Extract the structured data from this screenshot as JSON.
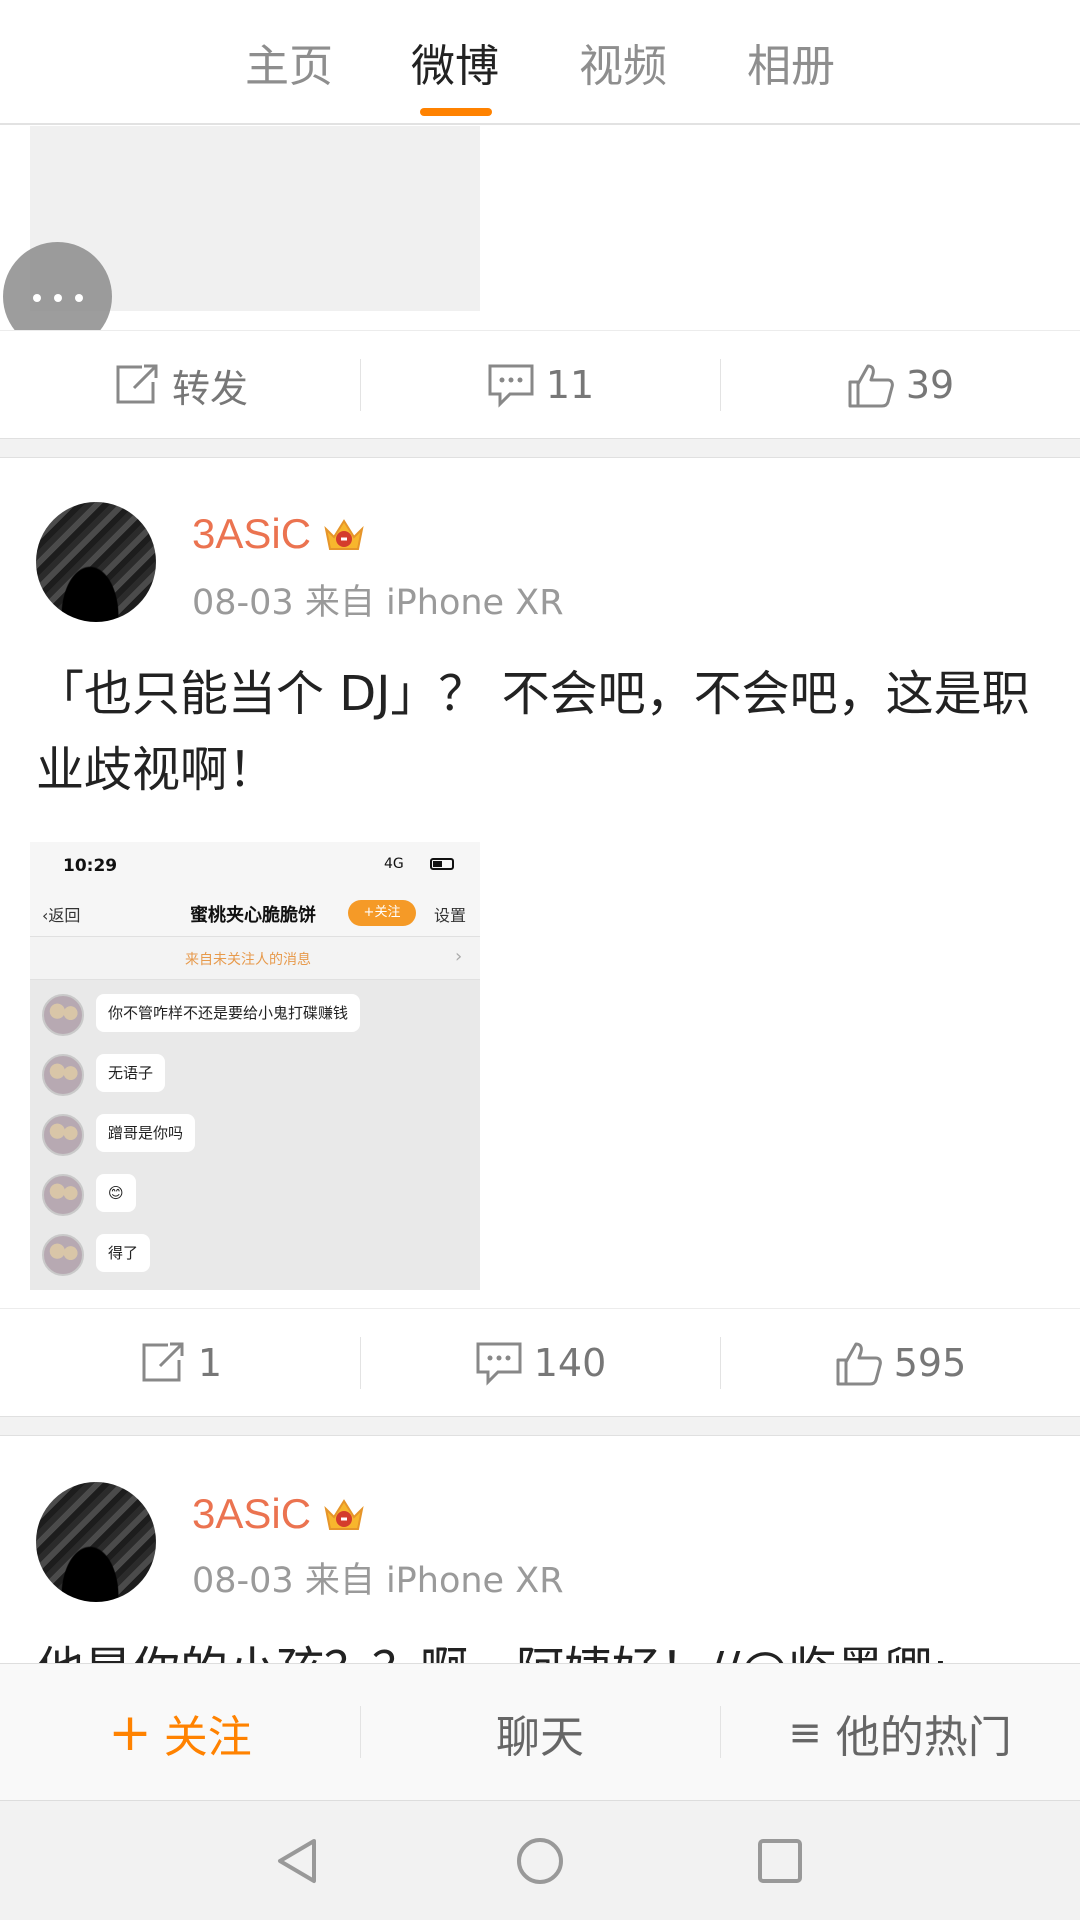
{
  "tabs": [
    {
      "label": "主页",
      "active": false
    },
    {
      "label": "微博",
      "active": true
    },
    {
      "label": "视频",
      "active": false
    },
    {
      "label": "相册",
      "active": false
    }
  ],
  "accent_color": "#ff8200",
  "username_color": "#eb7350",
  "post0": {
    "more_icon": "more-dots-icon",
    "actions": {
      "repost": "转发",
      "comments": "11",
      "likes": "39"
    }
  },
  "posts": [
    {
      "username": "3ASiC",
      "badge_icon": "crown-vip-icon",
      "meta": "08-03 来自 iPhone XR",
      "text": "「也只能当个 DJ」？ 不会吧，不会吧，这是职业歧视啊！",
      "image": {
        "time": "10:29",
        "signal": "4G",
        "back": "返回",
        "title": "蜜桃夹心脆脆饼",
        "follow": "+关注",
        "settings": "设置",
        "notice": "来自未关注人的消息",
        "messages": [
          "你不管咋样不还是要给小鬼打碟赚钱",
          "无语子",
          "蹭哥是你吗",
          "😊",
          "得了"
        ]
      },
      "actions": {
        "repost": "1",
        "comments": "140",
        "likes": "595"
      }
    },
    {
      "username": "3ASiC",
      "badge_icon": "crown-vip-icon",
      "meta": "08-03 来自 iPhone XR",
      "text": "他是你的小孩？？啊，阿姨好！//@临墨卿:"
    }
  ],
  "followbar": {
    "follow": "关注",
    "chat": "聊天",
    "hot": "他的热门"
  },
  "sysnav": {
    "back": "back-triangle-icon",
    "home": "home-circle-icon",
    "recents": "recents-square-icon"
  }
}
